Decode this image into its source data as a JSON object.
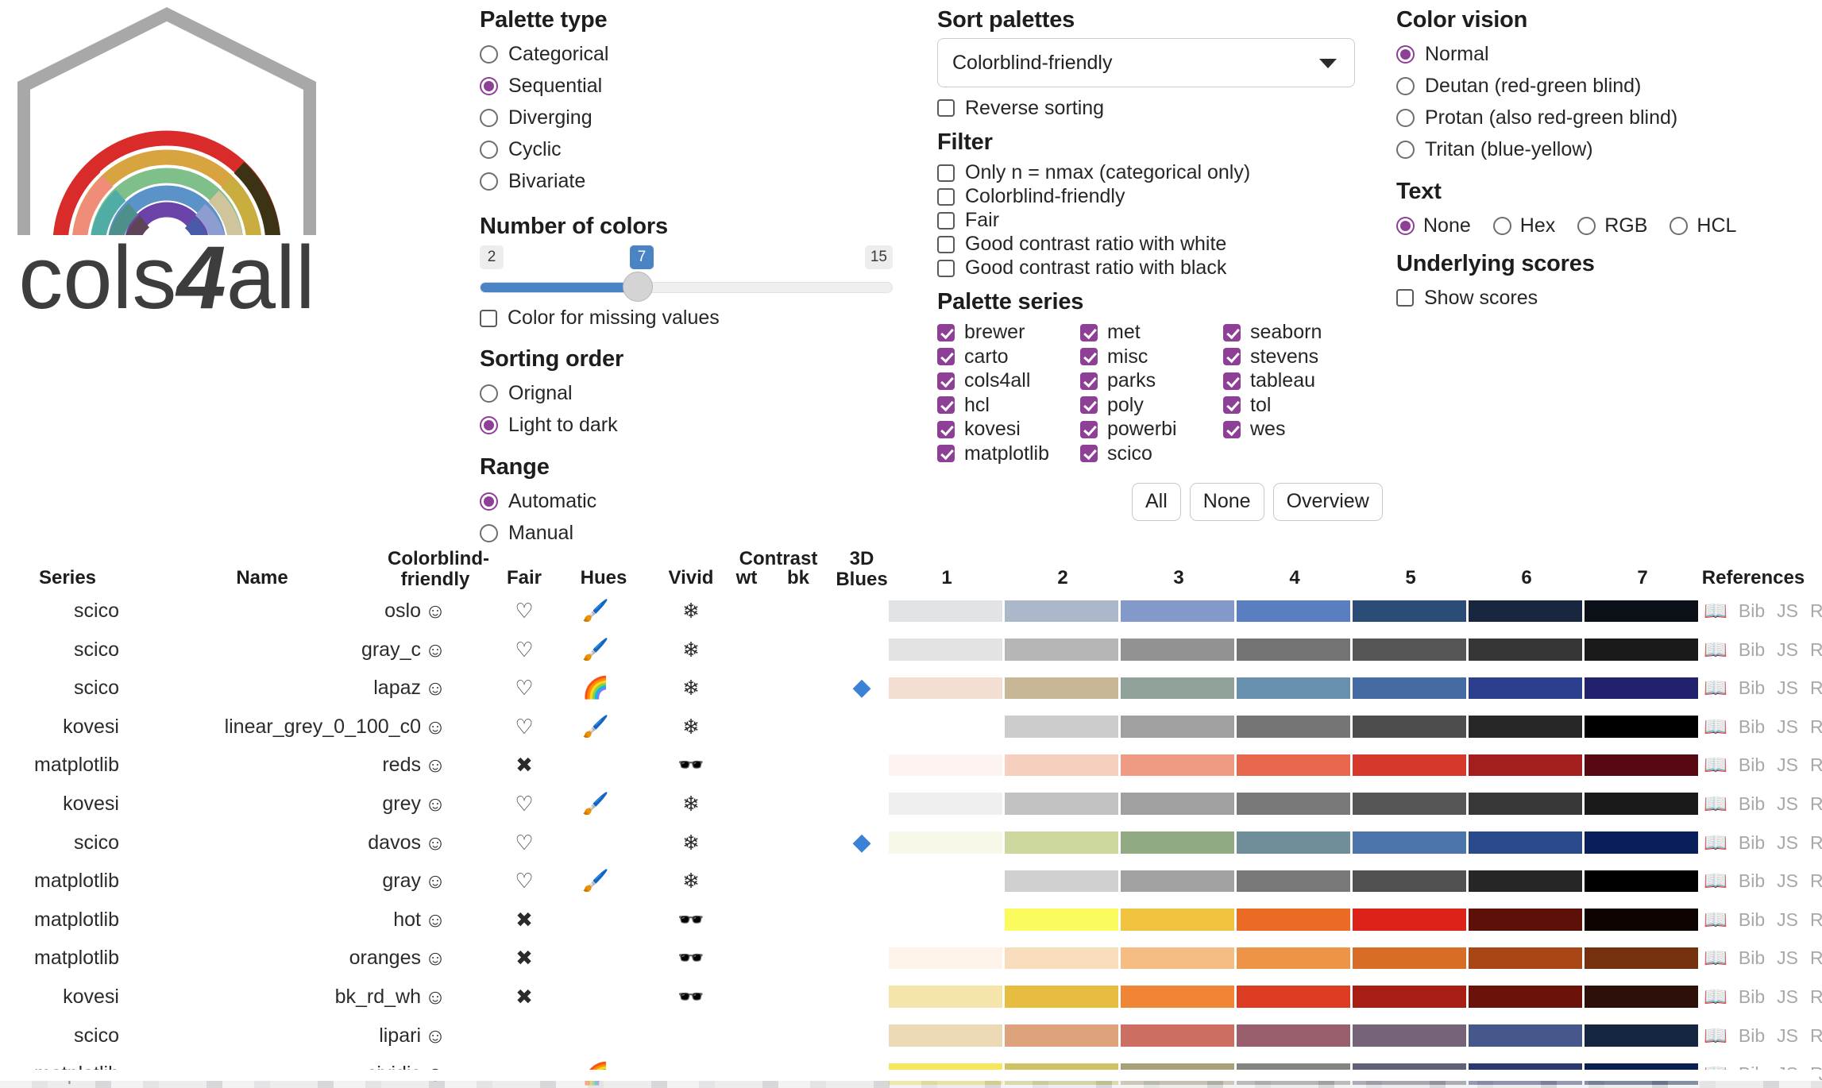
{
  "logo": {
    "alt": "cols4all",
    "wordmark": "cols4all"
  },
  "palette_type": {
    "title": "Palette type",
    "options": [
      "Categorical",
      "Sequential",
      "Diverging",
      "Cyclic",
      "Bivariate"
    ],
    "selected": "Sequential"
  },
  "number_of_colors": {
    "title": "Number of colors",
    "min": "2",
    "max": "15",
    "value": "7",
    "missing_label": "Color for missing values",
    "missing_checked": false
  },
  "sorting_order": {
    "title": "Sorting order",
    "options": [
      "Orignal",
      "Light to dark"
    ],
    "selected": "Light to dark"
  },
  "range": {
    "title": "Range",
    "options": [
      "Automatic",
      "Manual"
    ],
    "selected": "Automatic"
  },
  "sort_palettes": {
    "title": "Sort palettes",
    "selected": "Colorblind-friendly",
    "reverse_label": "Reverse sorting",
    "reverse_checked": false
  },
  "filter": {
    "title": "Filter",
    "options": [
      "Only n = nmax (categorical only)",
      "Colorblind-friendly",
      "Fair",
      "Good contrast ratio with white",
      "Good contrast ratio with black"
    ]
  },
  "palette_series": {
    "title": "Palette series",
    "col1": [
      "brewer",
      "carto",
      "cols4all",
      "hcl",
      "kovesi",
      "matplotlib"
    ],
    "col2": [
      "met",
      "misc",
      "parks",
      "poly",
      "powerbi",
      "scico"
    ],
    "col3": [
      "seaborn",
      "stevens",
      "tableau",
      "tol",
      "wes"
    ],
    "buttons": [
      "All",
      "None",
      "Overview"
    ]
  },
  "color_vision": {
    "title": "Color vision",
    "options": [
      "Normal",
      "Deutan (red-green blind)",
      "Protan (also red-green blind)",
      "Tritan (blue-yellow)"
    ],
    "selected": "Normal"
  },
  "text": {
    "title": "Text",
    "options": [
      "None",
      "Hex",
      "RGB",
      "HCL"
    ],
    "selected": "None"
  },
  "underlying_scores": {
    "title": "Underlying scores",
    "show_label": "Show scores",
    "show_checked": false
  },
  "accent_colors": {
    "radio": "#8e3f96",
    "checkbox": "#8e3f96",
    "slider": "#4a84c4",
    "diamond": "#3b82d6"
  },
  "table": {
    "headers": {
      "series": "Series",
      "name": "Name",
      "colorblind_friendly": "Colorblind-\nfriendly",
      "fair": "Fair",
      "hues": "Hues",
      "vivid": "Vivid",
      "contrast": "Contrast",
      "contrast_wt": "wt",
      "contrast_bk": "bk",
      "blues3d": "3D\nBlues",
      "color_columns": [
        "1",
        "2",
        "3",
        "4",
        "5",
        "6",
        "7"
      ],
      "references": "References"
    },
    "reference_links": [
      "Bib",
      "JS",
      "R"
    ],
    "book_icon": "open-book",
    "rows": [
      {
        "series": "scico",
        "name": "oslo",
        "cbf": "smiley",
        "fair": "heart",
        "hues": "paintbrush",
        "vivid": "snowflake",
        "blues3d": false,
        "colors": [
          "#e2e3e6",
          "#adb7ca",
          "#8299ca",
          "#5a7fc0",
          "#2c4c78",
          "#18263f",
          "#0b1018"
        ]
      },
      {
        "series": "scico",
        "name": "gray_c",
        "cbf": "smiley",
        "fair": "heart",
        "hues": "paintbrush",
        "vivid": "snowflake",
        "blues3d": false,
        "colors": [
          "#e3e3e3",
          "#b6b6b6",
          "#929292",
          "#737373",
          "#565656",
          "#363636",
          "#191919"
        ]
      },
      {
        "series": "scico",
        "name": "lapaz",
        "cbf": "smiley",
        "fair": "heart",
        "hues": "rainbow",
        "vivid": "snowflake",
        "blues3d": true,
        "colors": [
          "#f2ded2",
          "#c7b797",
          "#8fa199",
          "#6690ae",
          "#446ba4",
          "#2b3f8e",
          "#22216e"
        ]
      },
      {
        "series": "kovesi",
        "name": "linear_grey_0_100_c0",
        "cbf": "smiley",
        "fair": "heart",
        "hues": "paintbrush",
        "vivid": "snowflake",
        "blues3d": false,
        "colors": [
          "#ffffff",
          "#cccccc",
          "#a0a0a0",
          "#757575",
          "#4d4d4d",
          "#272727",
          "#000000"
        ]
      },
      {
        "series": "matplotlib",
        "name": "reds",
        "cbf": "smiley",
        "fair": "cross",
        "hues": "",
        "vivid": "sunglasses",
        "blues3d": false,
        "colors": [
          "#fdf4f2",
          "#f5d0bf",
          "#ef9a82",
          "#e9674d",
          "#d6382c",
          "#a31f1d",
          "#580812"
        ]
      },
      {
        "series": "kovesi",
        "name": "grey",
        "cbf": "smiley",
        "fair": "heart",
        "hues": "paintbrush",
        "vivid": "snowflake",
        "blues3d": false,
        "colors": [
          "#efefef",
          "#c2c2c2",
          "#a0a0a0",
          "#787878",
          "#565656",
          "#373737",
          "#1a1a1a"
        ]
      },
      {
        "series": "scico",
        "name": "davos",
        "cbf": "smiley",
        "fair": "heart",
        "hues": "",
        "vivid": "snowflake",
        "blues3d": true,
        "colors": [
          "#f8f8e8",
          "#ccd79d",
          "#91aa83",
          "#6e8e99",
          "#4c76ab",
          "#2a4a8c",
          "#0b1e5c"
        ]
      },
      {
        "series": "matplotlib",
        "name": "gray",
        "cbf": "smiley",
        "fair": "heart",
        "hues": "paintbrush",
        "vivid": "snowflake",
        "blues3d": false,
        "colors": [
          "#ffffff",
          "#d0d0d0",
          "#a2a2a2",
          "#787878",
          "#505050",
          "#262626",
          "#000000"
        ]
      },
      {
        "series": "matplotlib",
        "name": "hot",
        "cbf": "smiley",
        "fair": "cross",
        "hues": "",
        "vivid": "sunglasses",
        "blues3d": false,
        "colors": [
          "#ffffff",
          "#fcfb5e",
          "#f2c33e",
          "#ec6b24",
          "#dd2319",
          "#5c1008",
          "#0c0300"
        ]
      },
      {
        "series": "matplotlib",
        "name": "oranges",
        "cbf": "smiley",
        "fair": "cross",
        "hues": "",
        "vivid": "sunglasses",
        "blues3d": false,
        "colors": [
          "#fdf3e8",
          "#f8ddbc",
          "#f5bd82",
          "#ee9449",
          "#d76d26",
          "#a84615",
          "#75300d"
        ]
      },
      {
        "series": "kovesi",
        "name": "bk_rd_wh",
        "cbf": "smiley",
        "fair": "cross",
        "hues": "",
        "vivid": "sunglasses",
        "blues3d": false,
        "colors": [
          "#f5e4ab",
          "#e7bd41",
          "#ef8535",
          "#dc3c22",
          "#a81e14",
          "#6b120a",
          "#2e100a"
        ]
      },
      {
        "series": "scico",
        "name": "lipari",
        "cbf": "smiley",
        "fair": "",
        "hues": "",
        "vivid": "",
        "blues3d": false,
        "colors": [
          "#ecd9b6",
          "#dda27b",
          "#cc6e61",
          "#995f6c",
          "#766279",
          "#46578b",
          "#14263f"
        ]
      },
      {
        "series": "matplotlib",
        "name": "cividis",
        "cbf": "smiley",
        "fair": "",
        "hues": "rainbow",
        "vivid": "",
        "blues3d": false,
        "colors": [
          "#f6e65c",
          "#cfc263",
          "#a6a179",
          "#83837f",
          "#5e6177",
          "#2d3a72",
          "#0a2051"
        ]
      }
    ]
  }
}
